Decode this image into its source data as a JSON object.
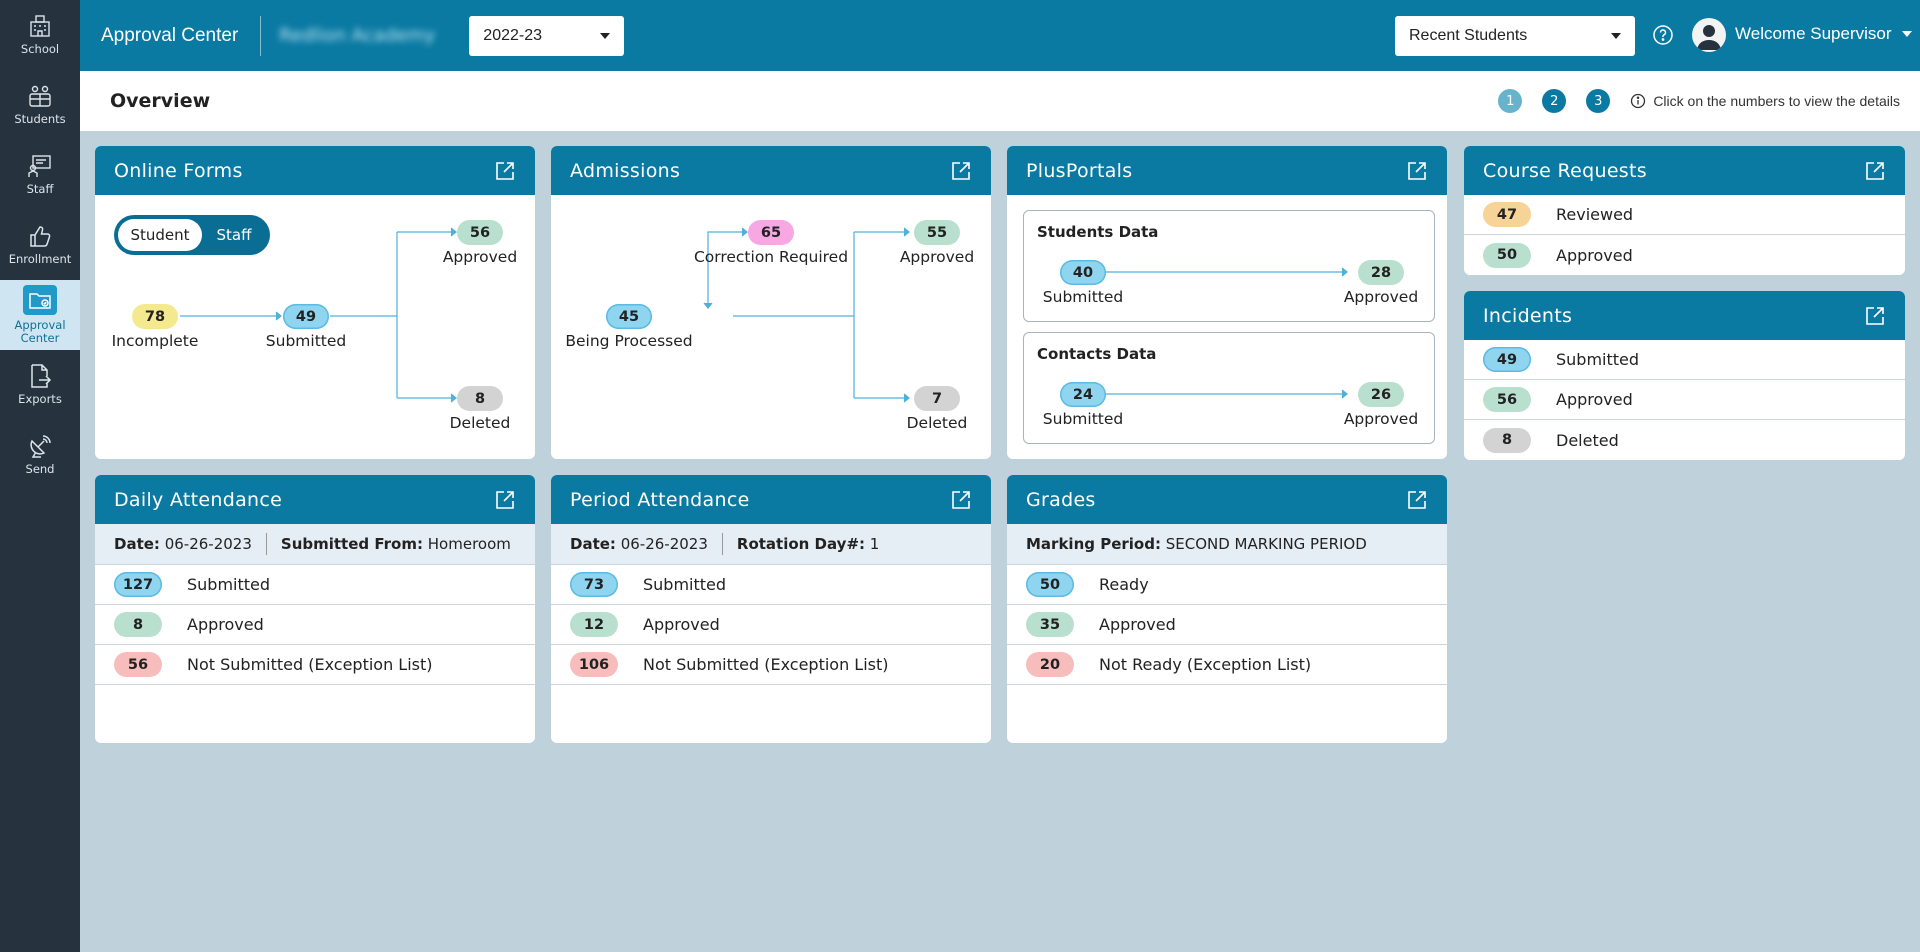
{
  "sidebar": {
    "items": [
      {
        "label": "School",
        "icon": "school-icon"
      },
      {
        "label": "Students",
        "icon": "students-icon"
      },
      {
        "label": "Staff",
        "icon": "staff-icon"
      },
      {
        "label": "Enrollment",
        "icon": "thumbs-up-icon"
      },
      {
        "label_line1": "Approval",
        "label_line2": "Center",
        "icon": "folder-approval-icon",
        "active": true
      },
      {
        "label": "Exports",
        "icon": "export-file-icon"
      },
      {
        "label": "Send",
        "icon": "satellite-dish-icon"
      }
    ]
  },
  "topbar": {
    "app_title": "Approval Center",
    "school_name": "Redlion Academy",
    "school_year": "2022-23",
    "recent_students": "Recent Students",
    "welcome": "Welcome Supervisor"
  },
  "overview": {
    "title": "Overview",
    "legend": [
      "1",
      "2",
      "3"
    ],
    "legend_colors": [
      "#67b3cc",
      "#0a7aa3",
      "#0a7aa3"
    ],
    "hint": "Click on the numbers to view the details"
  },
  "online_forms": {
    "title": "Online Forms",
    "toggle": {
      "student": "Student",
      "staff": "Staff"
    },
    "incomplete": {
      "value": "78",
      "label": "Incomplete"
    },
    "submitted": {
      "value": "49",
      "label": "Submitted"
    },
    "approved": {
      "value": "56",
      "label": "Approved"
    },
    "deleted": {
      "value": "8",
      "label": "Deleted"
    }
  },
  "admissions": {
    "title": "Admissions",
    "correction": {
      "value": "65",
      "label": "Correction Required"
    },
    "processing": {
      "value": "45",
      "label": "Being Processed"
    },
    "approved": {
      "value": "55",
      "label": "Approved"
    },
    "deleted": {
      "value": "7",
      "label": "Deleted"
    }
  },
  "plusportals": {
    "title": "PlusPortals",
    "students": {
      "title": "Students Data",
      "submitted_value": "40",
      "submitted_label": "Submitted",
      "approved_value": "28",
      "approved_label": "Approved"
    },
    "contacts": {
      "title": "Contacts Data",
      "submitted_value": "24",
      "submitted_label": "Submitted",
      "approved_value": "26",
      "approved_label": "Approved"
    }
  },
  "course_requests": {
    "title": "Course Requests",
    "rows": [
      {
        "value": "47",
        "label": "Reviewed",
        "color": "orange"
      },
      {
        "value": "50",
        "label": "Approved",
        "color": "green"
      }
    ]
  },
  "incidents": {
    "title": "Incidents",
    "rows": [
      {
        "value": "49",
        "label": "Submitted",
        "color": "blue"
      },
      {
        "value": "56",
        "label": "Approved",
        "color": "green"
      },
      {
        "value": "8",
        "label": "Deleted",
        "color": "gray"
      }
    ]
  },
  "daily_attendance": {
    "title": "Daily Attendance",
    "date_label": "Date:",
    "date": "06-26-2023",
    "from_label": "Submitted From:",
    "from": "Homeroom",
    "rows": [
      {
        "value": "127",
        "label": "Submitted",
        "color": "blue"
      },
      {
        "value": "8",
        "label": "Approved",
        "color": "green"
      },
      {
        "value": "56",
        "label": "Not Submitted (Exception List)",
        "color": "red"
      }
    ]
  },
  "period_attendance": {
    "title": "Period Attendance",
    "date_label": "Date:",
    "date": "06-26-2023",
    "rotation_label": "Rotation Day#:",
    "rotation": "1",
    "rows": [
      {
        "value": "73",
        "label": "Submitted",
        "color": "blue"
      },
      {
        "value": "12",
        "label": "Approved",
        "color": "green"
      },
      {
        "value": "106",
        "label": "Not Submitted (Exception List)",
        "color": "red"
      }
    ]
  },
  "grades": {
    "title": "Grades",
    "period_label": "Marking Period:",
    "period": "SECOND MARKING PERIOD",
    "rows": [
      {
        "value": "50",
        "label": "Ready",
        "color": "blue"
      },
      {
        "value": "35",
        "label": "Approved",
        "color": "green"
      },
      {
        "value": "20",
        "label": "Not Ready (Exception List)",
        "color": "red"
      }
    ]
  }
}
